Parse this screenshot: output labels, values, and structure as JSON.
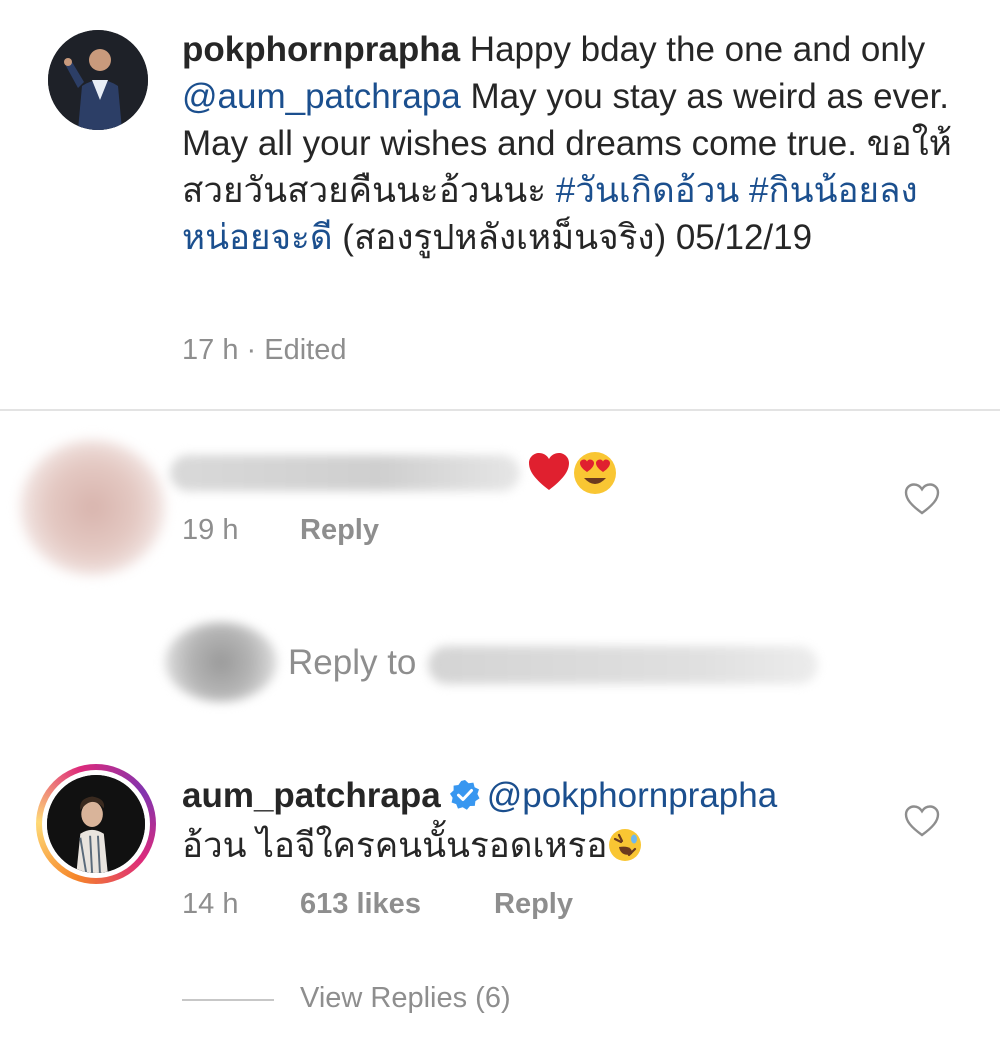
{
  "caption": {
    "username": "pokphornprapha",
    "text_1": " Happy bday the one and only ",
    "mention": "@aum_patchrapa",
    "text_2": " May you stay as weird as ever. May all your wishes and dreams come true. ขอให้สวยวันสวยคืนนะอ้วนนะ ",
    "hashtag_1": "#วันเกิดอ้วน",
    "hashtag_2": "#กินน้อยลงหน่อยจะดี",
    "text_3": " (สองรูปหลังเหม็นจริง) 05/12/19",
    "time": "17 h",
    "separator": " · ",
    "edited": "Edited"
  },
  "comment_1": {
    "time": "19 h",
    "reply_label": "Reply"
  },
  "reply_to": {
    "label": "Reply to"
  },
  "comment_2": {
    "username": "aum_patchrapa",
    "mention": "@pokphornprapha",
    "text": "อ้วน ไอจีใครคนนั้นรอดเหรอ",
    "time": "14 h",
    "likes": "613 likes",
    "reply_label": "Reply"
  },
  "view_replies": {
    "label": "View Replies (6)"
  },
  "icons": {
    "like": "heart-outline-icon",
    "verified": "verified-badge-icon",
    "emoji_heart": "red-heart-emoji",
    "emoji_heart_eyes": "heart-eyes-emoji",
    "emoji_rofl": "rolling-laughing-emoji"
  },
  "colors": {
    "link": "#1b4f8e",
    "secondary_text": "#8e8e8e",
    "verified_blue": "#3897f0"
  }
}
